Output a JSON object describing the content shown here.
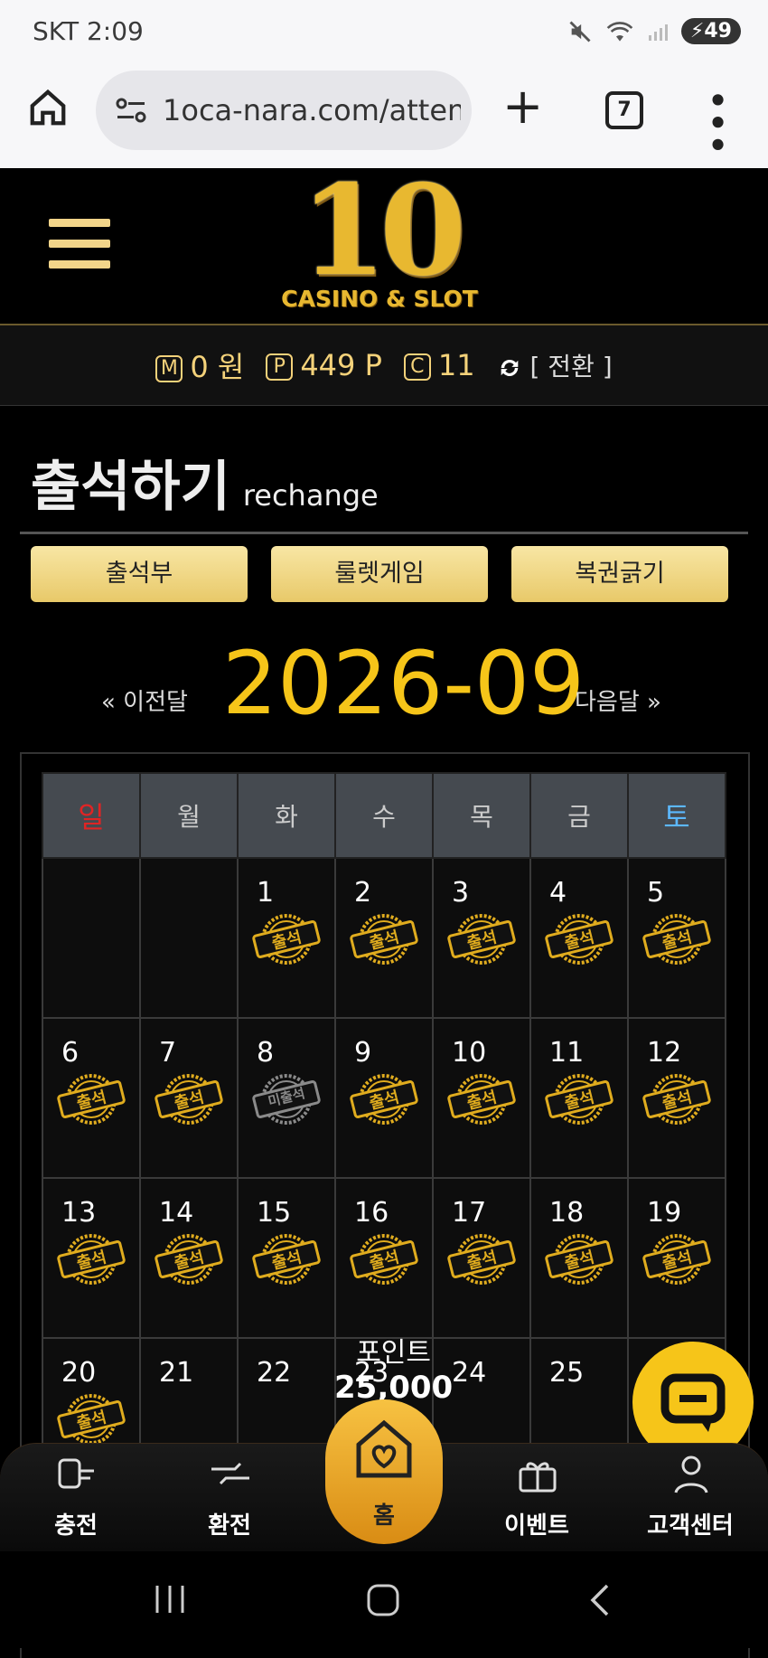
{
  "status_bar": {
    "time": "SKT 2:09",
    "battery": "49"
  },
  "browser": {
    "url": "1oca-nara.com/atten",
    "tab_count": "7"
  },
  "site": {
    "logo_number": "10",
    "logo_sub": "CASINO & SLOT"
  },
  "wallet": {
    "m_label": "M",
    "m_value": "0 원",
    "p_label": "P",
    "p_value": "449 P",
    "c_label": "C",
    "c_value": "11",
    "switch_label": "[ 전환 ]"
  },
  "page": {
    "title": "출석하기",
    "subtitle": "rechange"
  },
  "tabs": {
    "attendance": "출석부",
    "roulette": "룰렛게임",
    "lottery": "복권긁기"
  },
  "calendar": {
    "prev_label": "« 이전달",
    "next_label": "다음달 »",
    "month": "2026-09",
    "weekdays": [
      "일",
      "월",
      "화",
      "수",
      "목",
      "금",
      "토"
    ],
    "rows": [
      [
        "",
        "",
        "1",
        "2",
        "3",
        "4",
        "5"
      ],
      [
        "6",
        "7",
        "8",
        "9",
        "10",
        "11",
        "12"
      ],
      [
        "13",
        "14",
        "15",
        "16",
        "17",
        "18",
        "19"
      ],
      [
        "20",
        "21",
        "22",
        "23",
        "24",
        "25",
        ""
      ]
    ],
    "stamp_attended": "출석",
    "stamp_missed": "미출석"
  },
  "popup": {
    "label": "포인트",
    "amount": "25,000"
  },
  "bottom_nav": {
    "charge": "충전",
    "exchange": "환전",
    "home": "홈",
    "event": "이벤트",
    "support": "고객센터"
  },
  "colors": {
    "gold": "#f6c519",
    "sunday": "#e02424",
    "saturday": "#5cb8ff"
  }
}
